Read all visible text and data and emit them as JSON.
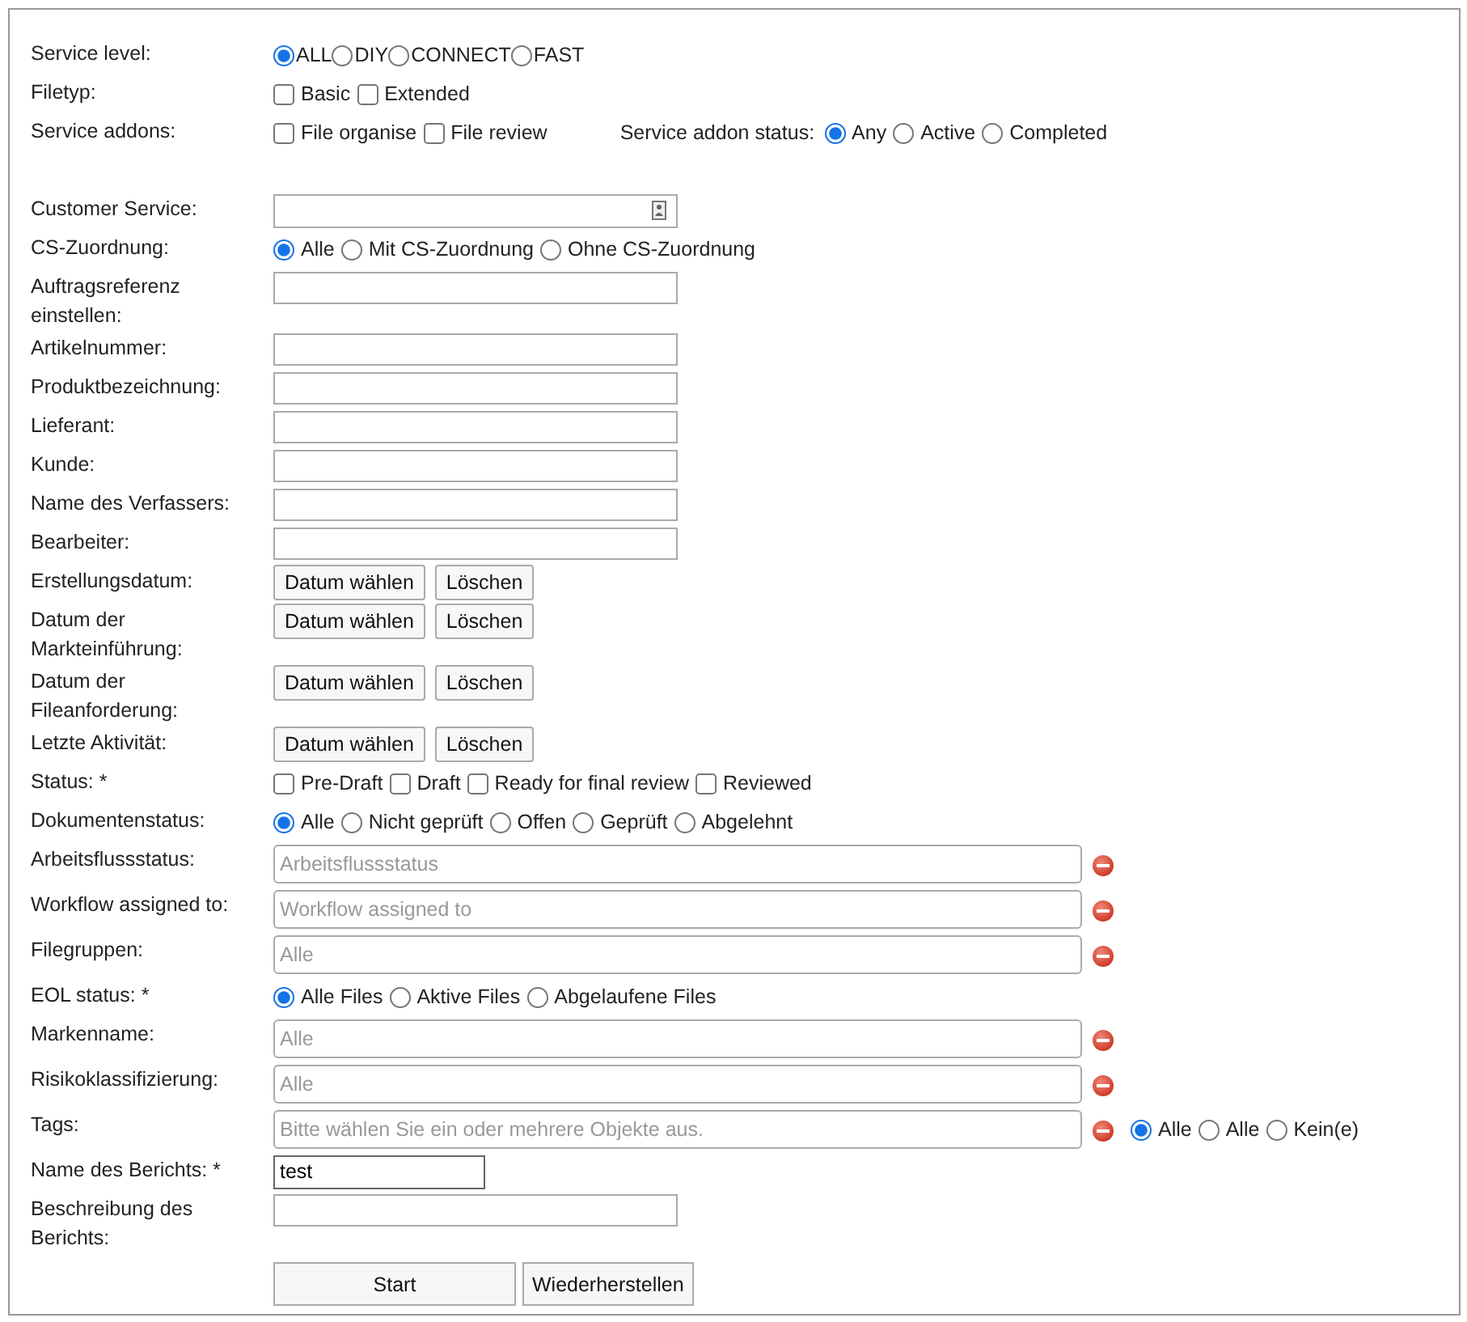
{
  "sections": [
    [
      {
        "kind": "radios",
        "label": "Service level:",
        "options": [
          {
            "label": "ALL",
            "selected": true
          },
          {
            "label": "DIY",
            "selected": false
          },
          {
            "label": "CONNECT",
            "selected": false
          },
          {
            "label": "FAST",
            "selected": false
          }
        ]
      },
      {
        "kind": "checkboxes",
        "label": "Filetyp:",
        "options": [
          {
            "label": "Basic",
            "checked": false
          },
          {
            "label": "Extended",
            "checked": false
          }
        ]
      },
      {
        "kind": "checkboxes",
        "label": "Service addons:",
        "options": [
          {
            "label": "File organise",
            "checked": false
          },
          {
            "label": "File review",
            "checked": false
          }
        ],
        "extra": {
          "label": "Service addon status:",
          "options": [
            {
              "label": "Any",
              "selected": true
            },
            {
              "label": "Active",
              "selected": false
            },
            {
              "label": "Completed",
              "selected": false
            }
          ]
        }
      }
    ],
    [
      {
        "kind": "lookup",
        "label": "Customer Service:"
      },
      {
        "kind": "radios",
        "label": "CS-Zuordnung:",
        "options": [
          {
            "label": "Alle",
            "selected": true
          },
          {
            "label": "Mit CS-Zuordnung",
            "selected": false
          },
          {
            "label": "Ohne CS-Zuordnung",
            "selected": false
          }
        ]
      },
      {
        "kind": "text",
        "label": "Auftragsreferenz einstellen:"
      },
      {
        "kind": "text",
        "label": "Artikelnummer:"
      },
      {
        "kind": "text",
        "label": "Produktbezeichnung:"
      },
      {
        "kind": "text",
        "label": "Lieferant:"
      },
      {
        "kind": "text",
        "label": "Kunde:"
      },
      {
        "kind": "text",
        "label": "Name des Verfassers:"
      },
      {
        "kind": "text",
        "label": "Bearbeiter:"
      },
      {
        "kind": "dates",
        "label": "Erstellungsdatum:",
        "buttons": [
          "Datum wählen",
          "Löschen"
        ]
      },
      {
        "kind": "dates",
        "label": "Datum der Markteinführung:",
        "buttons": [
          "Datum wählen",
          "Löschen"
        ]
      },
      {
        "kind": "dates",
        "label": "Datum der Fileanforderung:",
        "buttons": [
          "Datum wählen",
          "Löschen"
        ]
      },
      {
        "kind": "dates",
        "label": "Letzte Aktivität:",
        "buttons": [
          "Datum wählen",
          "Löschen"
        ]
      },
      {
        "kind": "checkboxes",
        "label": "Status: *",
        "options": [
          {
            "label": "Pre-Draft",
            "checked": false
          },
          {
            "label": "Draft",
            "checked": false
          },
          {
            "label": "Ready for final review",
            "checked": false
          },
          {
            "label": "Reviewed",
            "checked": false
          }
        ]
      },
      {
        "kind": "radios",
        "label": "Dokumentenstatus:",
        "options": [
          {
            "label": "Alle",
            "selected": true
          },
          {
            "label": "Nicht geprüft",
            "selected": false
          },
          {
            "label": "Offen",
            "selected": false
          },
          {
            "label": "Geprüft",
            "selected": false
          },
          {
            "label": "Abgelehnt",
            "selected": false
          }
        ]
      },
      {
        "kind": "select",
        "label": "Arbeitsflussstatus:",
        "placeholder": "Arbeitsflussstatus"
      },
      {
        "kind": "select",
        "label": "Workflow assigned to:",
        "placeholder": "Workflow assigned to"
      },
      {
        "kind": "select",
        "label": "Filegruppen:",
        "placeholder": "Alle"
      },
      {
        "kind": "radios",
        "label": "EOL status: *",
        "options": [
          {
            "label": "Alle Files",
            "selected": true
          },
          {
            "label": "Aktive Files",
            "selected": false
          },
          {
            "label": "Abgelaufene Files",
            "selected": false
          }
        ]
      },
      {
        "kind": "select",
        "label": "Markenname:",
        "placeholder": "Alle"
      },
      {
        "kind": "select",
        "label": "Risikoklassifizierung:",
        "placeholder": "Alle"
      },
      {
        "kind": "select",
        "label": "Tags:",
        "placeholder": "Bitte wählen Sie ein oder mehrere Objekte aus.",
        "options": [
          {
            "label": "Alle",
            "selected": true
          },
          {
            "label": "Alle",
            "selected": false
          },
          {
            "label": "Kein(e)",
            "selected": false
          }
        ]
      },
      {
        "kind": "short-text",
        "label": "Name des Berichts: *",
        "value": "test"
      },
      {
        "kind": "text",
        "label": "Beschreibung des Berichts:"
      }
    ]
  ],
  "actions": [
    {
      "label": "Start"
    },
    {
      "label": "Wiederherstellen"
    }
  ]
}
